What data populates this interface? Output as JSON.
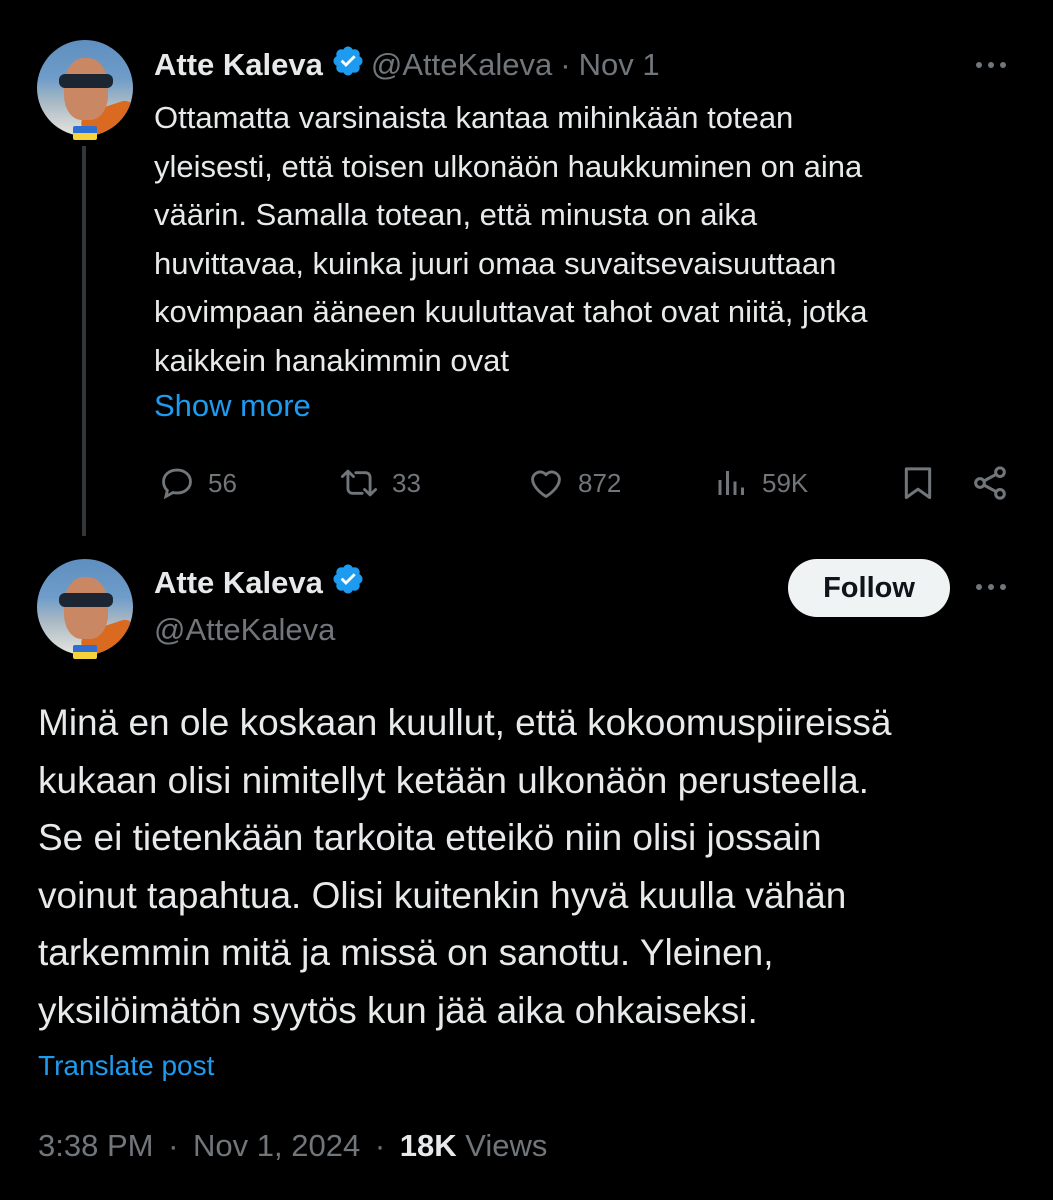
{
  "quoted_tweet": {
    "author_name": "Atte Kaleva",
    "handle": "@AtteKaleva",
    "separator": "·",
    "date": "Nov 1",
    "text": "Ottamatta varsinaista kantaa mihinkään totean\nyleisesti, että toisen ulkonäön haukkuminen on aina\nväärin. Samalla totean, että minusta on aika\nhuvittavaa, kuinka juuri omaa suvaitsevaisuuttaan\nkovimpaan ääneen kuuluttavat tahot ovat niitä, jotka\nkaikkein hanakimmin ovat",
    "show_more_label": "Show more",
    "actions": {
      "replies": "56",
      "reposts": "33",
      "likes": "872",
      "views": "59K"
    }
  },
  "main_tweet": {
    "author_name": "Atte Kaleva",
    "handle": "@AtteKaleva",
    "follow_label": "Follow",
    "text": "Minä en ole koskaan kuullut, että kokoomuspiireissä\nkukaan olisi nimitellyt ketään ulkonäön perusteella.\nSe ei tietenkään tarkoita etteikö niin olisi jossain\nvoinut tapahtua. Olisi kuitenkin hyvä kuulla vähän\ntarkemmin mitä ja missä on sanottu. Yleinen,\nyksilöimätön syytös kun jää aika ohkaiseksi.",
    "translate_label": "Translate post",
    "time": "3:38 PM",
    "separator": "·",
    "date": "Nov 1, 2024",
    "views_count": "18K",
    "views_label": "Views"
  },
  "icons": {
    "verified": "verified-badge-icon",
    "more": "more-icon",
    "reply": "reply-icon",
    "repost": "repost-icon",
    "like": "heart-icon",
    "views": "views-icon",
    "bookmark": "bookmark-icon",
    "share": "share-icon"
  },
  "colors": {
    "background": "#000000",
    "text": "#e7e9ea",
    "muted": "#71767b",
    "accent": "#1d9bf0",
    "verified": "#1d9bf0",
    "follow_button_bg": "#eff3f4"
  }
}
